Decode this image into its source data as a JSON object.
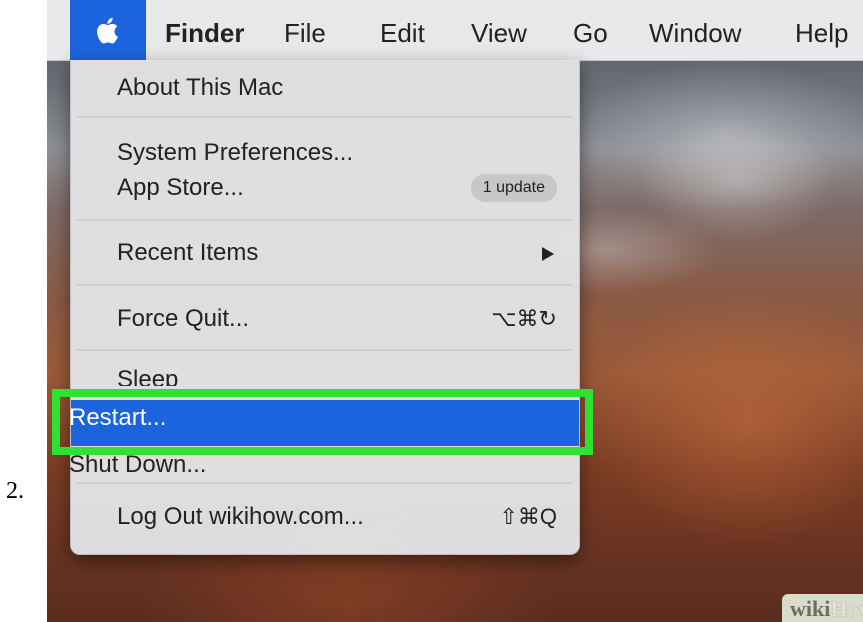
{
  "step_number": "2.",
  "menubar": {
    "apple_icon": "apple-logo-icon",
    "items": [
      "Finder",
      "File",
      "Edit",
      "View",
      "Go",
      "Window",
      "Help"
    ]
  },
  "apple_menu": {
    "about": "About This Mac",
    "system_preferences": "System Preferences...",
    "app_store": "App Store...",
    "app_store_badge": "1 update",
    "recent_items": "Recent Items",
    "recent_items_arrow": "submenu-arrow-icon",
    "force_quit": "Force Quit...",
    "force_quit_shortcut": "⌥⌘↻",
    "sleep": "Sleep",
    "restart": "Restart...",
    "shut_down": "Shut Down...",
    "log_out": "Log Out wikihow.com...",
    "log_out_shortcut": "⇧⌘Q"
  },
  "highlight_color": "#31e131",
  "selection_color": "#1c64de",
  "watermark": {
    "part1": "wiki",
    "part2": "How"
  }
}
